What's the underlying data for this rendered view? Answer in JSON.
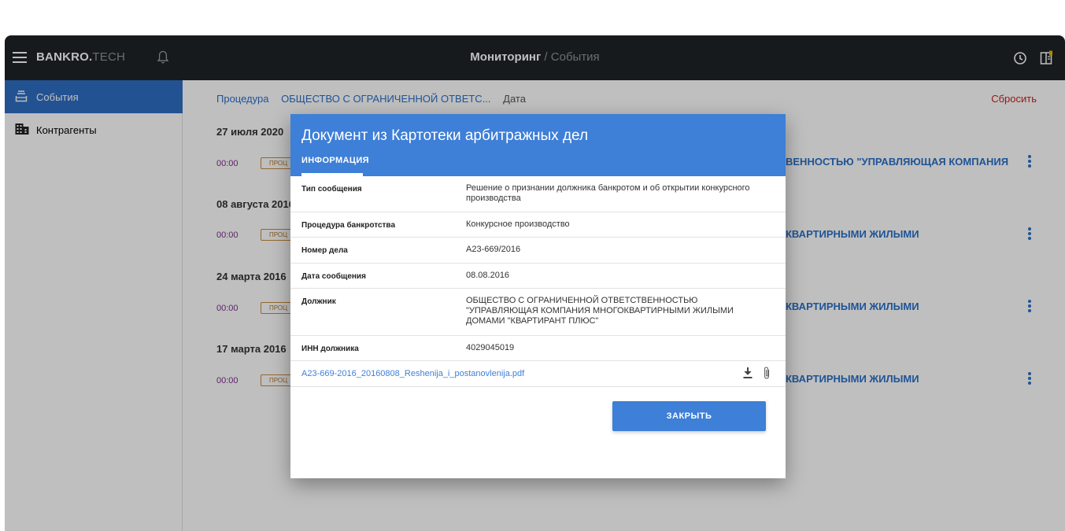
{
  "app": {
    "brand_bold": "BANKRO.",
    "brand_light": "TECH",
    "title_main": "Мониторинг",
    "title_sep": " / ",
    "title_sub": "События"
  },
  "sidebar": {
    "items": [
      {
        "label": "События",
        "icon": "inbox-tray-icon",
        "active": true
      },
      {
        "label": "Контрагенты",
        "icon": "building-icon",
        "active": false
      }
    ]
  },
  "filters": {
    "procedure_label": "Процедура",
    "company_label": "ОБЩЕСТВО С ОГРАНИЧЕННОЙ ОТВЕТС...",
    "date_label": "Дата",
    "reset_label": "Сбросить"
  },
  "events": [
    {
      "date": "27 июля 2020",
      "time": "00:00",
      "chip": "ПРОЦ",
      "text": "ВЕННОСТЬЮ \"УПРАВЛЯЮЩАЯ КОМПАНИЯ"
    },
    {
      "date": "08 августа 2016",
      "time": "00:00",
      "chip": "ПРОЦ",
      "text": "КВАРТИРНЫМИ ЖИЛЫМИ"
    },
    {
      "date": "24 марта 2016",
      "time": "00:00",
      "chip": "ПРОЦ",
      "text": "КВАРТИРНЫМИ ЖИЛЫМИ"
    },
    {
      "date": "17 марта 2016",
      "time": "00:00",
      "chip": "ПРОЦ",
      "text": "КВАРТИРНЫМИ ЖИЛЫМИ"
    }
  ],
  "modal": {
    "title": "Документ из Картотеки арбитражных дел",
    "tab": "ИНФОРМАЦИЯ",
    "rows": [
      {
        "key": "Тип сообщения",
        "value": "Решение о признании должника банкротом и об открытии конкурсного производства"
      },
      {
        "key": "Процедура банкротства",
        "value": "Конкурсное производство"
      },
      {
        "key": "Номер дела",
        "value": "А23-669/2016"
      },
      {
        "key": "Дата сообщения",
        "value": "08.08.2016"
      },
      {
        "key": "Должник",
        "value": "ОБЩЕСТВО С ОГРАНИЧЕННОЙ ОТВЕТСТВЕННОСТЬЮ \"УПРАВЛЯЮЩАЯ КОМПАНИЯ МНОГОКВАРТИРНЫМИ ЖИЛЫМИ ДОМАМИ \"КВАРТИРАНТ ПЛЮС\""
      },
      {
        "key": "ИНН должника",
        "value": "4029045019"
      }
    ],
    "file_name": "А23-669-2016_20160808_Reshenija_i_postanovlenija.pdf",
    "close_label": "ЗАКРЫТЬ"
  },
  "colors": {
    "topbar": "#1f2326",
    "accent": "#3e7fd7",
    "sidebar_active": "#2f6ec3",
    "reset": "#c8221b"
  }
}
